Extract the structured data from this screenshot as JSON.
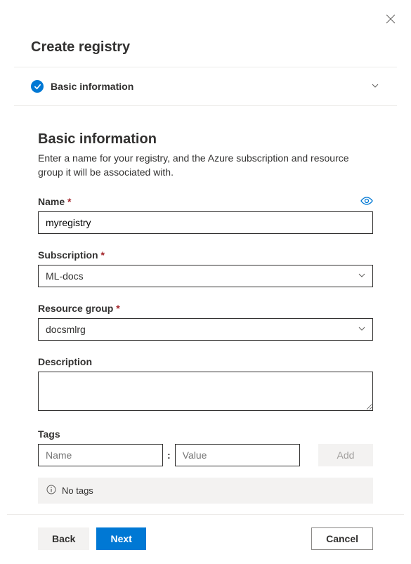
{
  "header": {
    "title": "Create registry"
  },
  "section": {
    "title": "Basic information"
  },
  "body": {
    "heading": "Basic information",
    "description": "Enter a name for your registry, and the Azure subscription and resource group it will be associated with."
  },
  "fields": {
    "name": {
      "label": "Name",
      "value": "myregistry"
    },
    "subscription": {
      "label": "Subscription",
      "value": "ML-docs"
    },
    "resource_group": {
      "label": "Resource group",
      "value": "docsmlrg"
    },
    "description": {
      "label": "Description",
      "value": ""
    },
    "tags": {
      "label": "Tags",
      "name_placeholder": "Name",
      "value_placeholder": "Value",
      "add_label": "Add",
      "empty_message": "No tags"
    }
  },
  "footer": {
    "back": "Back",
    "next": "Next",
    "cancel": "Cancel"
  }
}
